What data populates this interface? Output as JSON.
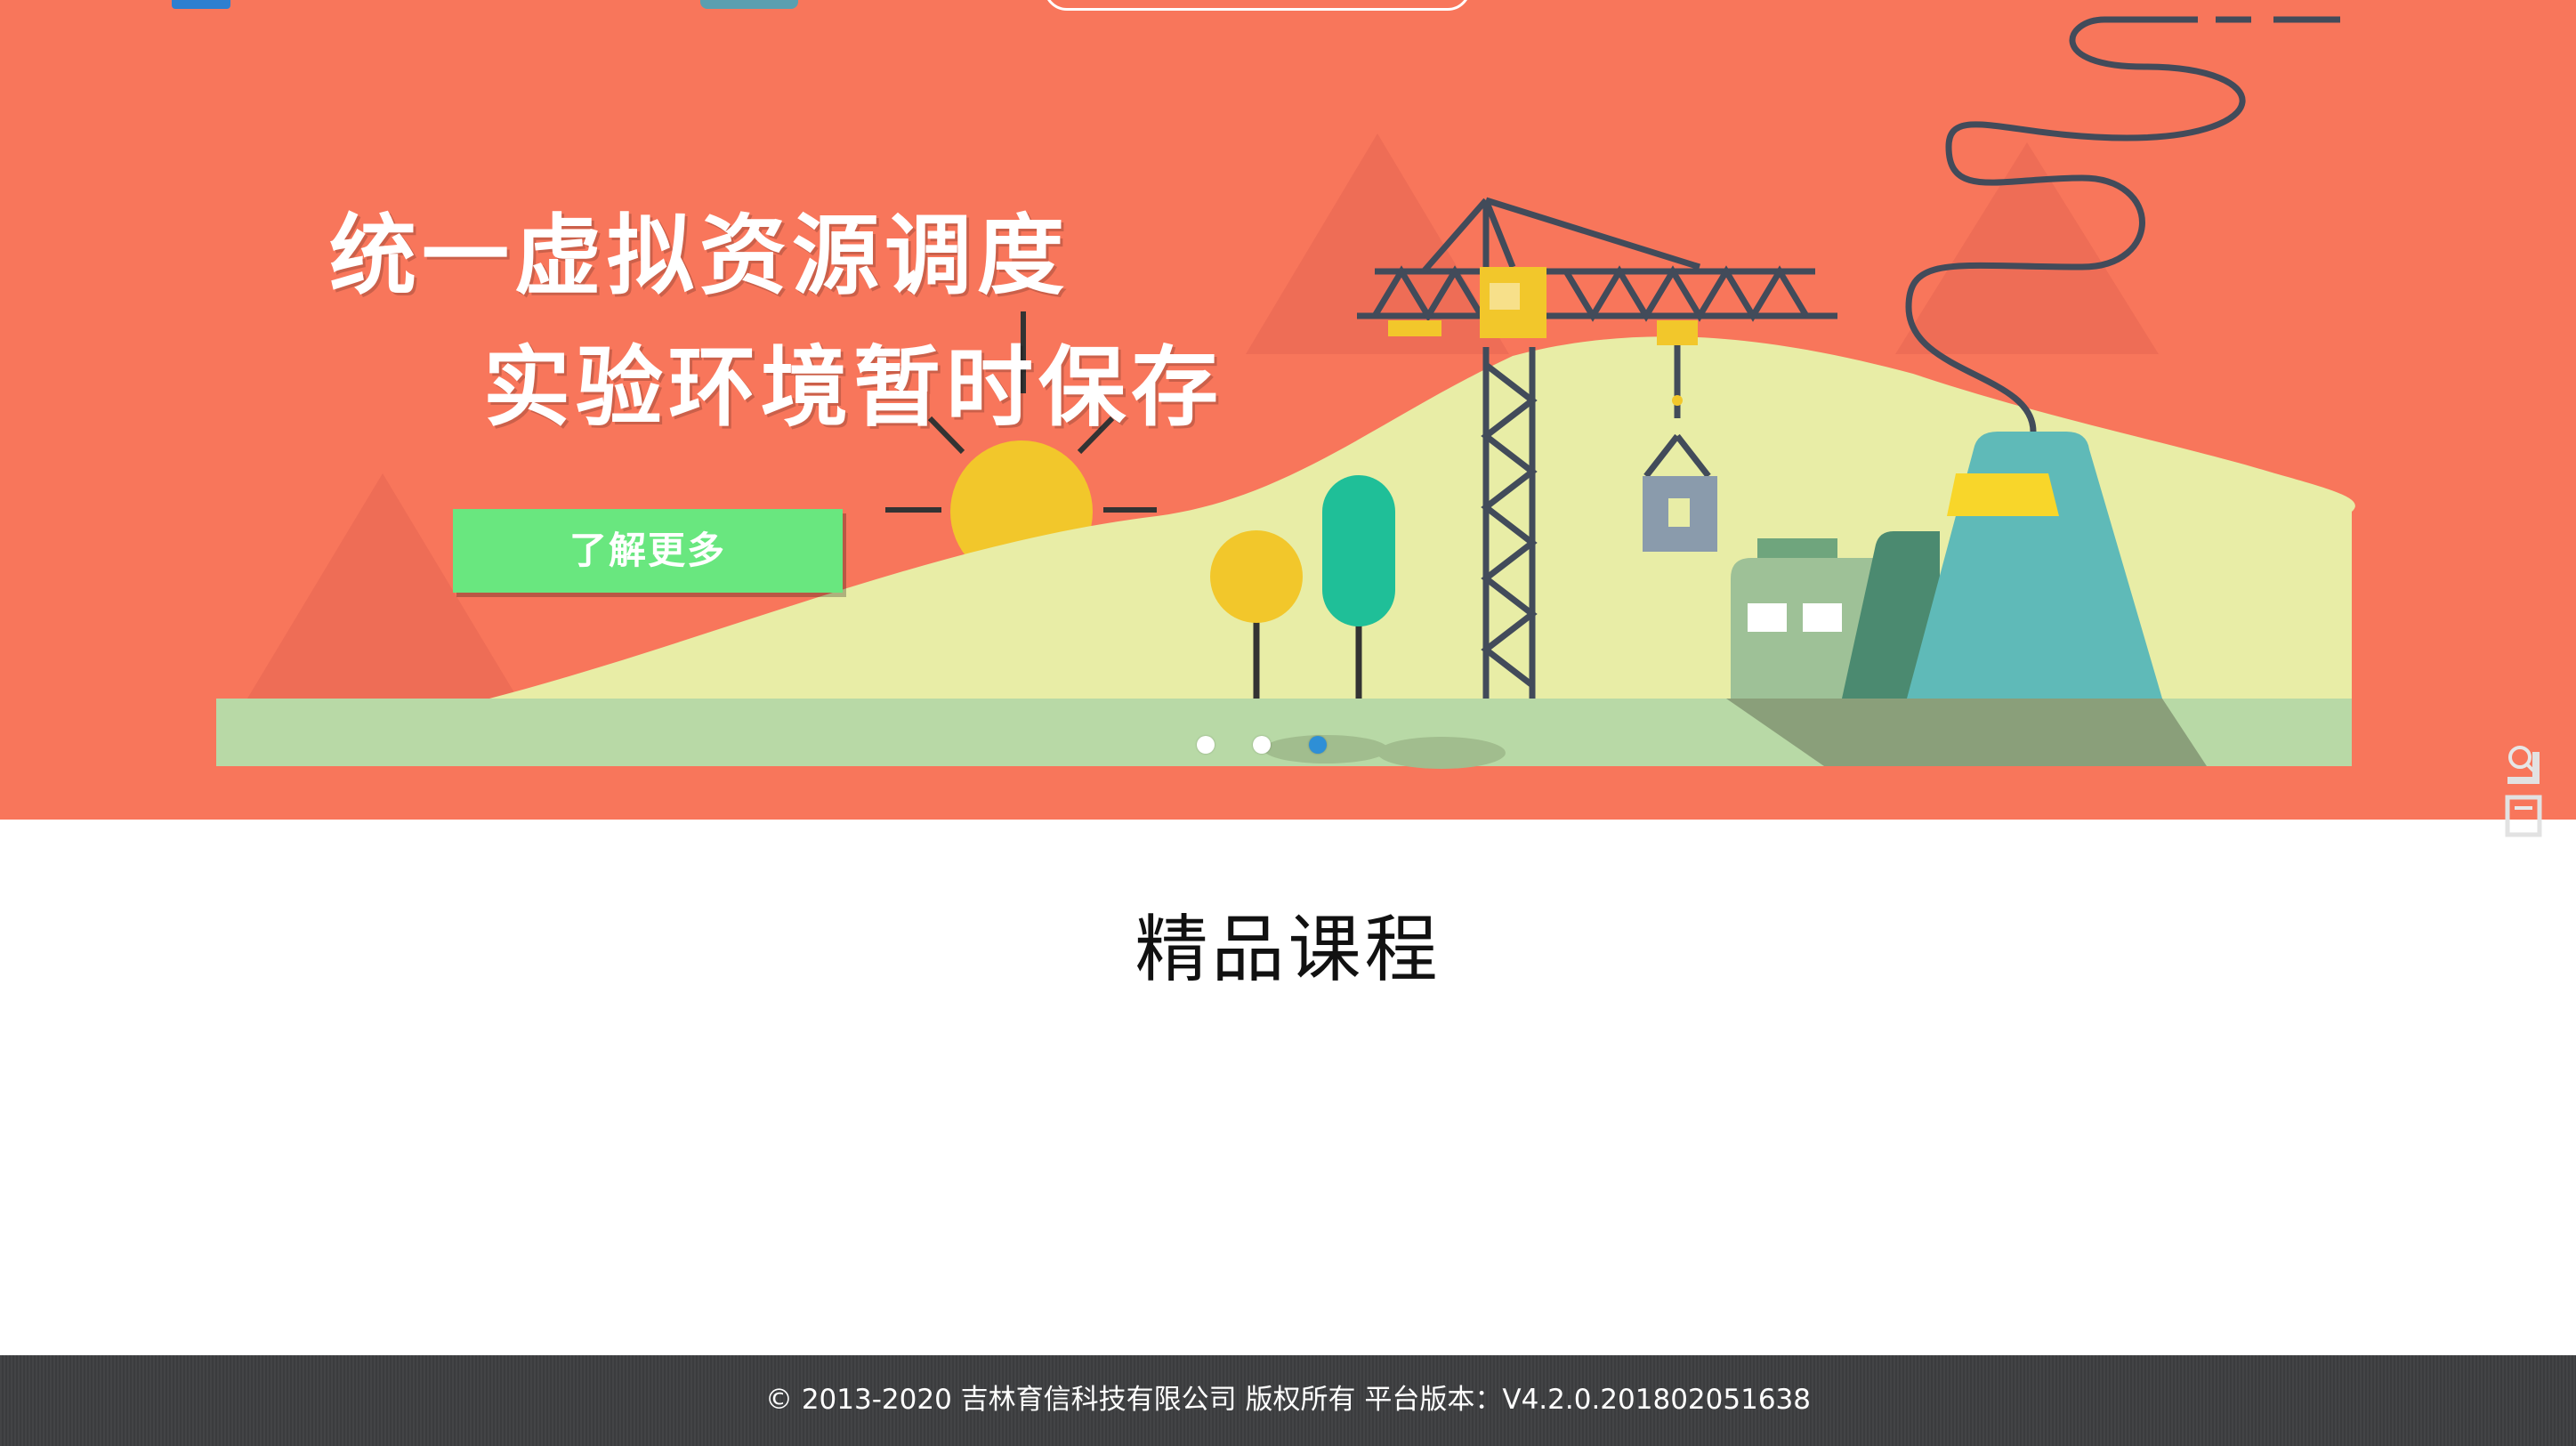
{
  "hero": {
    "line1": "统一虚拟资源调度",
    "line2": "实验环境暂时保存",
    "button_label": "了解更多",
    "slide_count": 3,
    "active_slide": 3
  },
  "section": {
    "title": "精品课程"
  },
  "footer": {
    "text": "© 2013-2020 吉林育信科技有限公司 版权所有 平台版本：V4.2.0.201802051638"
  },
  "colors": {
    "hero_background": "#f8765b",
    "cta_button": "#69e77f",
    "active_dot": "#2e8fd6",
    "footer_background": "#3d3e40"
  },
  "icons": {
    "side_search": "search-icon",
    "side_page": "page-icon"
  }
}
